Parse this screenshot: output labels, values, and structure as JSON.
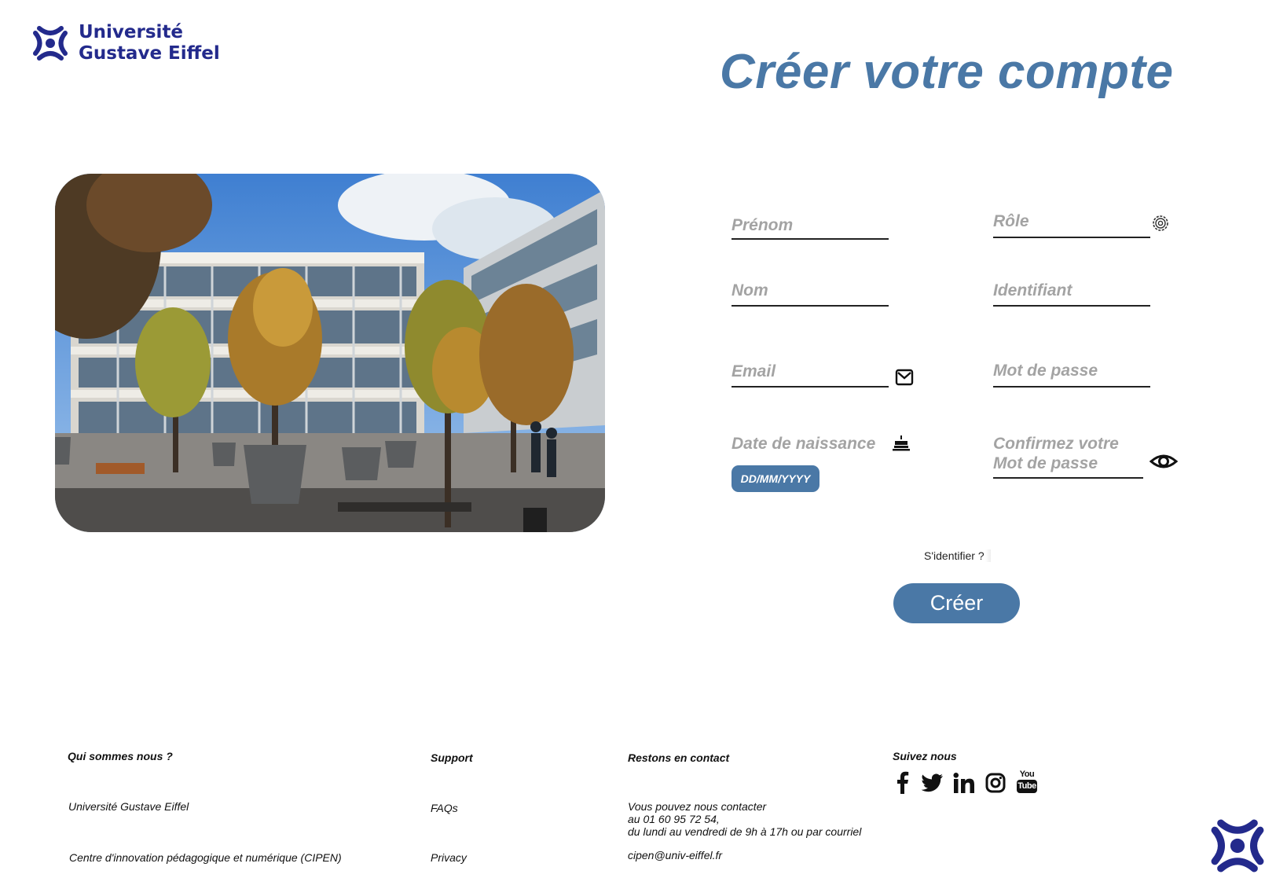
{
  "header": {
    "logo_line1": "Université",
    "logo_line2": "Gustave Eiffel",
    "title": "Créer votre compte"
  },
  "form": {
    "prenom": "Prénom",
    "role": "Rôle",
    "nom": "Nom",
    "identifiant": "Identifiant",
    "email": "Email",
    "password": "Mot de passe",
    "birthdate": "Date de naissance",
    "confirm_line1": "Confirmez votre",
    "confirm_line2": "Mot de passe",
    "date_placeholder": "DD/MM/YYYY",
    "signin_link": "S'identifier ?",
    "create_button": "Créer"
  },
  "icons": {
    "role": "gear-icon",
    "email": "mail-icon",
    "birthdate": "cake-icon",
    "confirm": "eye-icon"
  },
  "footer": {
    "col1_title": "Qui sommes nous ?",
    "col1_item1": "Université Gustave Eiffel",
    "col1_item2": "Centre d'innovation pédagogique et numérique (CIPEN)",
    "col2_title": "Support",
    "col2_item1": "FAQs",
    "col2_item2": "Privacy",
    "col3_title": "Restons en contact",
    "col3_line1": "Vous pouvez nous contacter",
    "col3_line2": "au 01 60 95 72 54,",
    "col3_line3": "du lundi au vendredi de 9h à 17h ou par courriel",
    "col3_email": "cipen@univ-eiffel.fr",
    "col4_title": "Suivez nous",
    "social": [
      "facebook-icon",
      "twitter-icon",
      "linkedin-icon",
      "instagram-icon",
      "youtube-icon"
    ],
    "youtube_top": "You",
    "youtube_bottom": "Tube"
  },
  "colors": {
    "brand_navy": "#232a8c",
    "accent_blue": "#4a78a6",
    "placeholder_gray": "#a3a3a3"
  }
}
